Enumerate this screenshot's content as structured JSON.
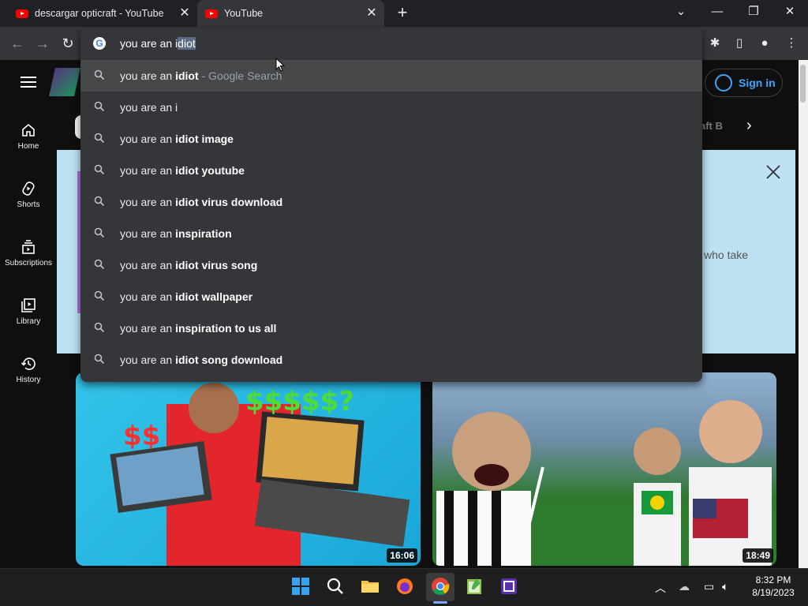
{
  "tabs": [
    {
      "title": "descargar opticraft - YouTube"
    },
    {
      "title": "YouTube"
    }
  ],
  "omnibox": {
    "typed": "you are an i",
    "completion": "diot"
  },
  "suggestions": [
    {
      "prefix": "you are an ",
      "bold": "idiot",
      "suffix": " - Google Search"
    },
    {
      "prefix": "you are an i",
      "bold": "",
      "suffix": ""
    },
    {
      "prefix": "you are an ",
      "bold": "idiot image",
      "suffix": ""
    },
    {
      "prefix": "you are an ",
      "bold": "idiot youtube",
      "suffix": ""
    },
    {
      "prefix": "you are an ",
      "bold": "idiot virus download",
      "suffix": ""
    },
    {
      "prefix": "you are an ",
      "bold": "inspiration",
      "suffix": ""
    },
    {
      "prefix": "you are an ",
      "bold": "idiot virus song",
      "suffix": ""
    },
    {
      "prefix": "you are an ",
      "bold": "idiot wallpaper",
      "suffix": ""
    },
    {
      "prefix": "you are an ",
      "bold": "inspiration to us all",
      "suffix": ""
    },
    {
      "prefix": "you are an ",
      "bold": "idiot song download",
      "suffix": ""
    }
  ],
  "youtube": {
    "signin": "Sign in",
    "guide": [
      "Home",
      "Shorts",
      "Subscriptions",
      "Library",
      "History"
    ],
    "chip_partial": "aft B",
    "banner_partial": "who take",
    "videos": [
      {
        "duration": "16:06"
      },
      {
        "duration": "18:49"
      }
    ]
  },
  "taskbar": {
    "time": "8:32 PM",
    "date": "8/19/2023"
  },
  "colors": {
    "accent_blue": "#3ea6ff",
    "youtube_red": "#ff0000",
    "banner_bg": "#bde0f3"
  }
}
